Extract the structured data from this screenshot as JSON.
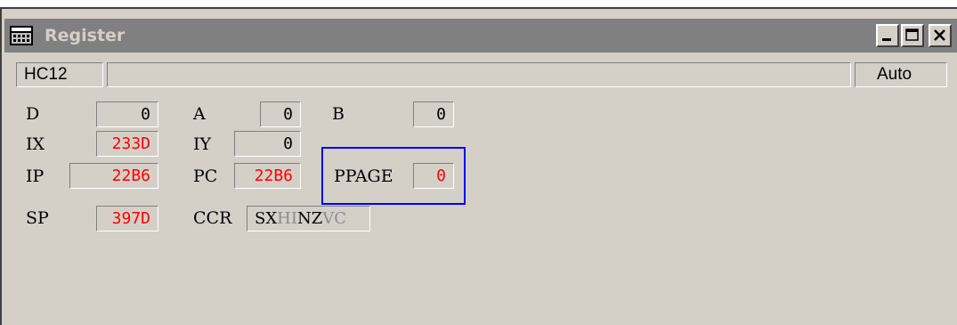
{
  "window": {
    "title": "Register",
    "icon": "register-window-icon",
    "controls": {
      "minimize": "minimize-icon",
      "maximize": "maximize-icon",
      "close": "close-icon"
    }
  },
  "toolbar": {
    "cpu": "HC12",
    "mode": "Auto"
  },
  "registers": {
    "D": {
      "label": "D",
      "value": "0"
    },
    "A": {
      "label": "A",
      "value": "0"
    },
    "B": {
      "label": "B",
      "value": "0"
    },
    "IX": {
      "label": "IX",
      "value": "233D"
    },
    "IY": {
      "label": "IY",
      "value": "0"
    },
    "IP": {
      "label": "IP",
      "value": "22B6"
    },
    "PC": {
      "label": "PC",
      "value": "22B6"
    },
    "PPAGE": {
      "label": "PPAGE",
      "value": "0"
    },
    "SP": {
      "label": "SP",
      "value": "397D"
    },
    "CCR": {
      "label": "CCR",
      "flags": [
        {
          "ch": "S",
          "set": true
        },
        {
          "ch": "X",
          "set": true
        },
        {
          "ch": "H",
          "set": false
        },
        {
          "ch": "I",
          "set": false
        },
        {
          "ch": "N",
          "set": true
        },
        {
          "ch": "Z",
          "set": true
        },
        {
          "ch": "V",
          "set": false
        },
        {
          "ch": "C",
          "set": false
        }
      ]
    }
  },
  "colors": {
    "changed_value": "#ff0000",
    "flag_set": "#000000",
    "flag_clear": "#8c8c8c",
    "highlight": "#0000ff",
    "titlebar": "#808080",
    "face": "#d4d0c8"
  }
}
